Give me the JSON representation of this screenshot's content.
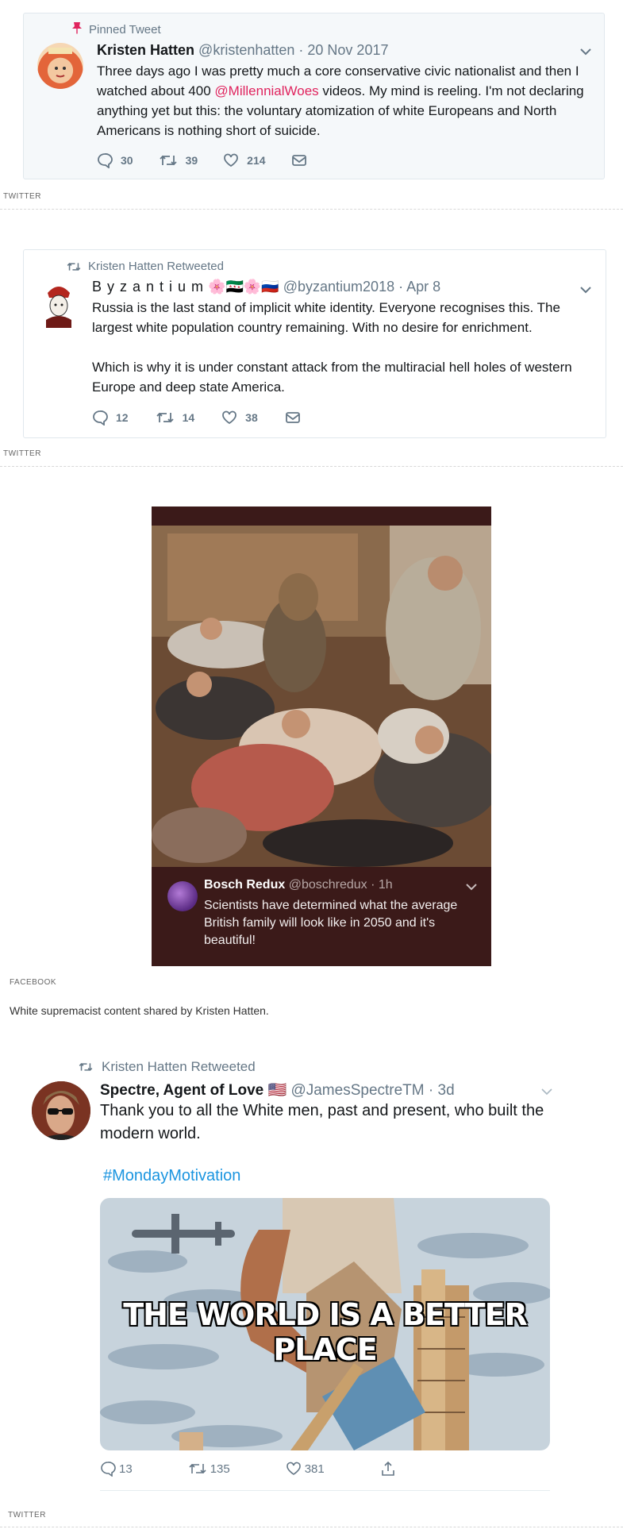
{
  "pinned_tweet": {
    "context": "Pinned Tweet",
    "name": "Kristen Hatten",
    "handle": "@kristenhatten",
    "date": "· 20 Nov 2017",
    "text_before_link": "Three days ago I was pretty much a core conservative civic nationalist and then I watched about 400 ",
    "link_text": "@MillennialWoes",
    "text_after_link": " videos. My mind is reeling. I'm not declaring anything yet but this: the voluntary atomization of white Europeans and North Americans is nothing short of suicide.",
    "replies": "30",
    "retweets": "39",
    "likes": "214",
    "source": "TWITTER"
  },
  "retweet_1": {
    "context": "Kristen Hatten Retweeted",
    "name": "B y z a n t i u m",
    "name_emoji": "🌸🇸🇾🌸🇷🇺",
    "handle": "@byzantium2018",
    "date": "· Apr 8",
    "text_p1": "Russia is the last stand of implicit white identity. Everyone recognises this. The largest white population country remaining. With no desire for enrichment.",
    "text_p2": "Which is why it is under constant attack from the multiracial hell holes of western Europe and deep state America.",
    "replies": "12",
    "retweets": "14",
    "likes": "38",
    "source": "TWITTER"
  },
  "facebook_post": {
    "name": "Bosch Redux",
    "handle": "@boschredux",
    "time": "· 1h",
    "text": "Scientists have determined what the average British family will look like in 2050 and it's beautiful!",
    "source": "FACEBOOK",
    "caption": "White supremacist content shared by Kristen Hatten."
  },
  "retweet_2": {
    "context": "Kristen Hatten Retweeted",
    "name": "Spectre, Agent of Love",
    "flag": "🇺🇸",
    "handle": "@JamesSpectreTM",
    "date": "· 3d",
    "text": "Thank you to all the White men, past and present, who built the modern world.",
    "hashtag": "#MondayMotivation",
    "meme_text": "THE WORLD IS A BETTER PLACE",
    "replies": "13",
    "retweets": "135",
    "likes": "381",
    "source": "TWITTER"
  },
  "colors": {
    "twitter_gray": "#657786",
    "mention_link": "#e0245e",
    "hashtag": "#1b95e0",
    "pinned_bg": "#f5f8fa",
    "fb_bg": "#3b1a19"
  }
}
